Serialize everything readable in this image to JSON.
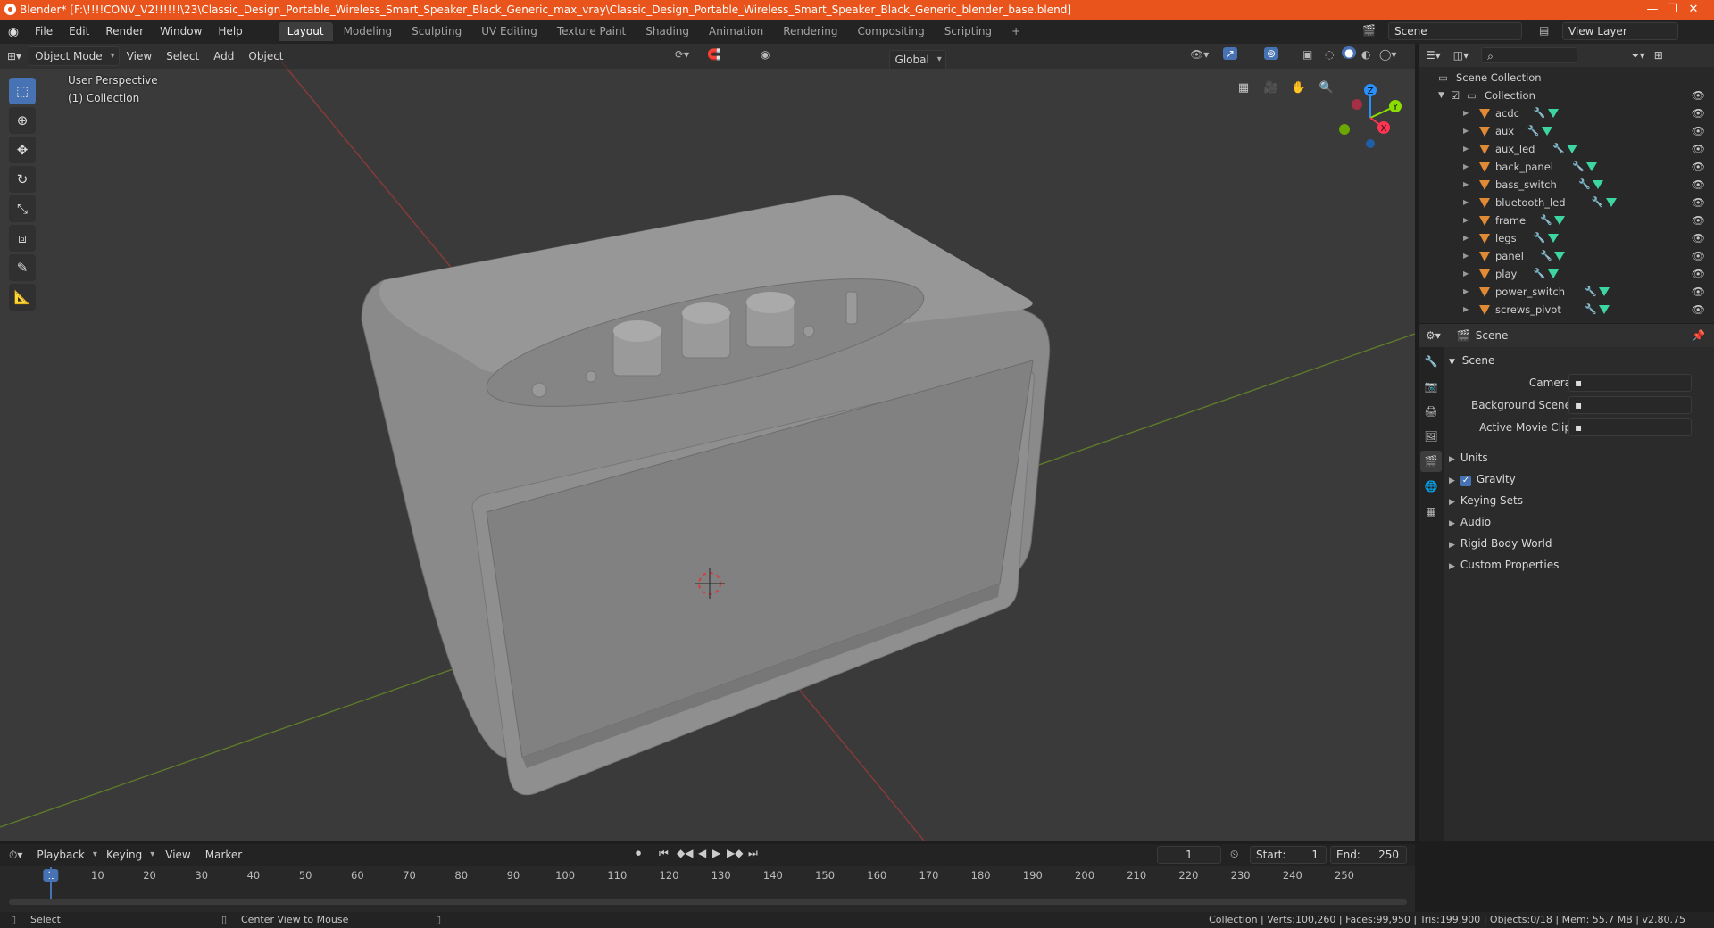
{
  "titlebar": {
    "title": "Blender* [F:\\!!!!CONV_V2!!!!!!\\23\\Classic_Design_Portable_Wireless_Smart_Speaker_Black_Generic_max_vray\\Classic_Design_Portable_Wireless_Smart_Speaker_Black_Generic_blender_base.blend]",
    "minimize": "—",
    "maximize": "❐",
    "close": "✕"
  },
  "menu": {
    "items": [
      "File",
      "Edit",
      "Render",
      "Window",
      "Help"
    ],
    "workspaces": [
      "Layout",
      "Modeling",
      "Sculpting",
      "UV Editing",
      "Texture Paint",
      "Shading",
      "Animation",
      "Rendering",
      "Compositing",
      "Scripting"
    ],
    "active_workspace": "Layout",
    "add_workspace": "+",
    "scene_label": "Scene",
    "view_layer_label": "View Layer"
  },
  "viewport_header": {
    "mode": "Object Mode",
    "view": "View",
    "select": "Select",
    "add": "Add",
    "object": "Object",
    "orientation": "Global"
  },
  "viewport": {
    "perspective": "User Perspective",
    "collection": "(1) Collection",
    "gizmo_axes": [
      "X",
      "Y",
      "Z"
    ]
  },
  "outliner": {
    "root": "Scene Collection",
    "collection": "Collection",
    "items": [
      "acdc",
      "aux",
      "aux_led",
      "back_panel",
      "bass_switch",
      "bluetooth_led",
      "frame",
      "legs",
      "panel",
      "play",
      "power_switch",
      "screws_pivot"
    ]
  },
  "properties": {
    "header": "Scene",
    "section_scene": "Scene",
    "camera_label": "Camera",
    "background_label": "Background Scene",
    "movie_clip_label": "Active Movie Clip",
    "sections": [
      "Units",
      "Gravity",
      "Keying Sets",
      "Audio",
      "Rigid Body World",
      "Custom Properties"
    ],
    "gravity_checked": true
  },
  "timeline": {
    "playback": "Playback",
    "keying": "Keying",
    "view": "View",
    "marker": "Marker",
    "current_frame": "1",
    "start_label": "Start:",
    "start": "1",
    "end_label": "End:",
    "end": "250",
    "ticks": [
      "1",
      "10",
      "20",
      "30",
      "40",
      "50",
      "60",
      "70",
      "80",
      "90",
      "100",
      "110",
      "120",
      "130",
      "140",
      "150",
      "160",
      "170",
      "180",
      "190",
      "200",
      "210",
      "220",
      "230",
      "240",
      "250"
    ]
  },
  "statusbar": {
    "select": "Select",
    "center_view": "Center View to Mouse",
    "stats": "Collection | Verts:100,260 | Faces:99,950 | Tris:199,900 | Objects:0/18 | Mem: 55.7 MB | v2.80.75"
  },
  "colors": {
    "titlebar": "#e8541c",
    "accent": "#4772b3",
    "x_axis": "#ff3352",
    "y_axis": "#8bdc00",
    "z_axis": "#2890ff"
  }
}
